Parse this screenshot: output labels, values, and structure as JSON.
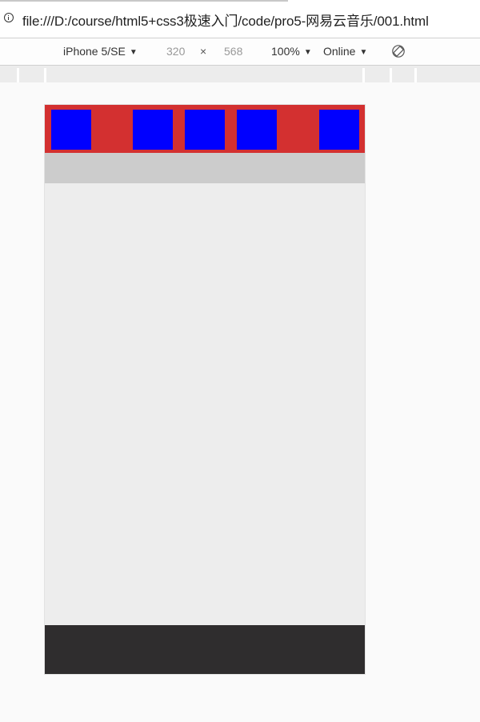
{
  "address_bar": {
    "url": "file:///D:/course/html5+css3极速入门/code/pro5-网易云音乐/001.html",
    "info_icon": "info-icon"
  },
  "device_toolbar": {
    "device": "iPhone 5/SE",
    "width": "320",
    "times": "×",
    "height": "568",
    "zoom": "100%",
    "throttle": "Online",
    "caret": "▼",
    "rotate_icon": "rotate-icon"
  },
  "emulated_page": {
    "header_color": "#d33030",
    "box_color": "#0000ff",
    "subbar_color": "#cccccc",
    "content_color": "#ededed",
    "footer_color": "#2f2d2e",
    "header_box_count": 5
  }
}
